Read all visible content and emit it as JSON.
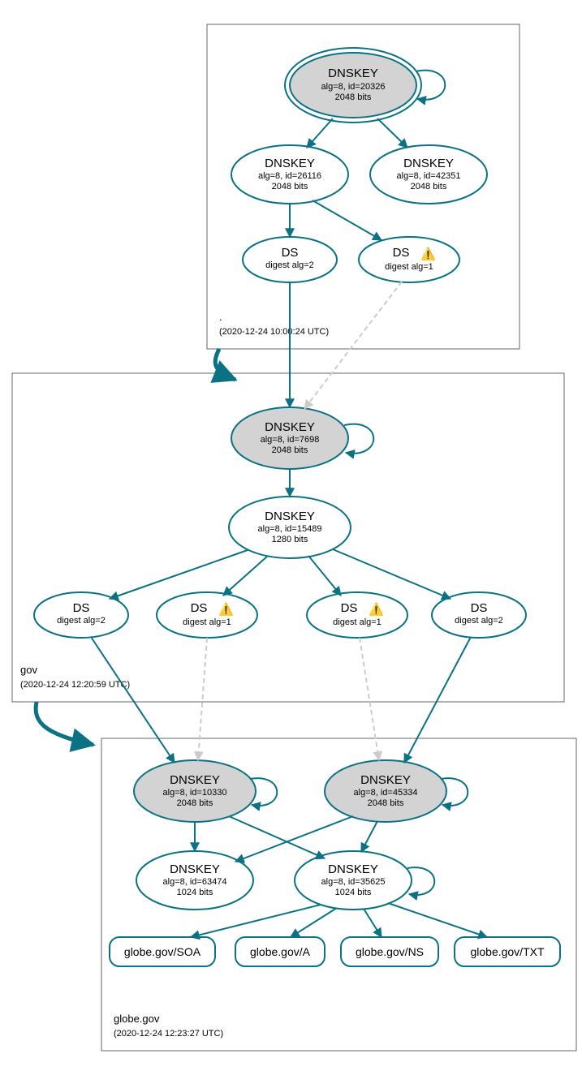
{
  "colors": {
    "stroke": "#0b7285",
    "filled": "#d3d3d3"
  },
  "zones": {
    "root": {
      "label": ".",
      "timestamp": "(2020-12-24 10:00:24 UTC)"
    },
    "gov": {
      "label": "gov",
      "timestamp": "(2020-12-24 12:20:59 UTC)"
    },
    "globe": {
      "label": "globe.gov",
      "timestamp": "(2020-12-24 12:23:27 UTC)"
    }
  },
  "nodes": {
    "root_ksk": {
      "title": "DNSKEY",
      "l2": "alg=8, id=20326",
      "l3": "2048 bits"
    },
    "root_zsk1": {
      "title": "DNSKEY",
      "l2": "alg=8, id=26116",
      "l3": "2048 bits"
    },
    "root_zsk2": {
      "title": "DNSKEY",
      "l2": "alg=8, id=42351",
      "l3": "2048 bits"
    },
    "root_ds1": {
      "title": "DS",
      "l2": "digest alg=2"
    },
    "root_ds2": {
      "title": "DS",
      "l2": "digest alg=1",
      "warn": true
    },
    "gov_ksk": {
      "title": "DNSKEY",
      "l2": "alg=8, id=7698",
      "l3": "2048 bits"
    },
    "gov_zsk": {
      "title": "DNSKEY",
      "l2": "alg=8, id=15489",
      "l3": "1280 bits"
    },
    "gov_ds1": {
      "title": "DS",
      "l2": "digest alg=2"
    },
    "gov_ds2": {
      "title": "DS",
      "l2": "digest alg=1",
      "warn": true
    },
    "gov_ds3": {
      "title": "DS",
      "l2": "digest alg=1",
      "warn": true
    },
    "gov_ds4": {
      "title": "DS",
      "l2": "digest alg=2"
    },
    "globe_ksk1": {
      "title": "DNSKEY",
      "l2": "alg=8, id=10330",
      "l3": "2048 bits"
    },
    "globe_ksk2": {
      "title": "DNSKEY",
      "l2": "alg=8, id=45334",
      "l3": "2048 bits"
    },
    "globe_zsk1": {
      "title": "DNSKEY",
      "l2": "alg=8, id=63474",
      "l3": "1024 bits"
    },
    "globe_zsk2": {
      "title": "DNSKEY",
      "l2": "alg=8, id=35625",
      "l3": "1024 bits"
    },
    "rr_soa": {
      "label": "globe.gov/SOA"
    },
    "rr_a": {
      "label": "globe.gov/A"
    },
    "rr_ns": {
      "label": "globe.gov/NS"
    },
    "rr_txt": {
      "label": "globe.gov/TXT"
    }
  }
}
